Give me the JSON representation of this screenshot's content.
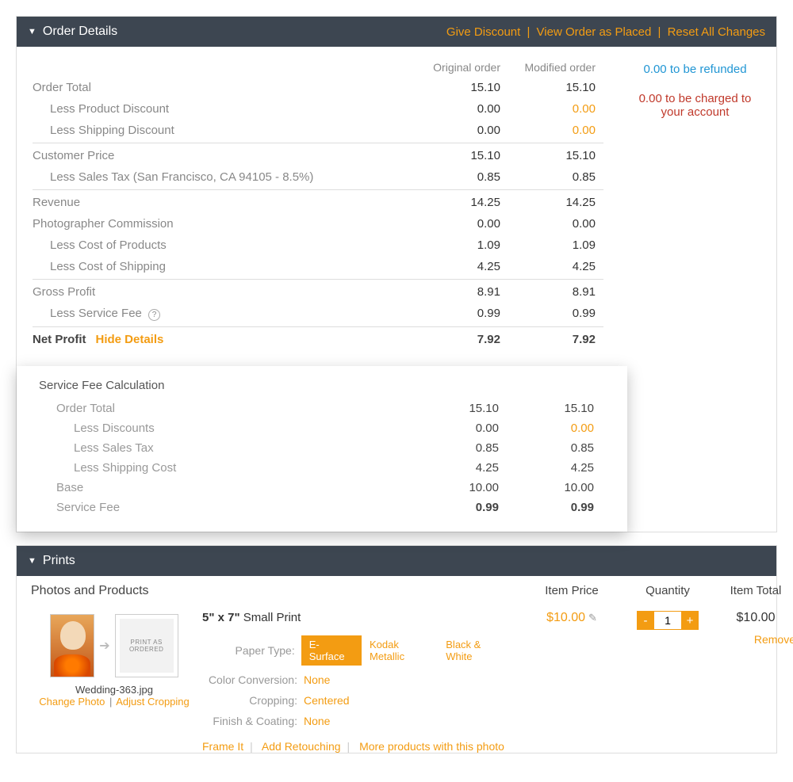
{
  "order_details": {
    "title": "Order Details",
    "header_links": {
      "give_discount": "Give Discount",
      "view_order": "View Order as Placed",
      "reset": "Reset All Changes"
    },
    "col_original": "Original order",
    "col_modified": "Modified order",
    "side": {
      "refund_amount": "0.00",
      "refund_suffix": "to be refunded",
      "charge_amount": "0.00",
      "charge_suffix": "to be charged to your account"
    },
    "rows": {
      "order_total": {
        "label": "Order Total",
        "orig": "15.10",
        "mod": "15.10"
      },
      "less_prod_disc": {
        "label": "Less Product Discount",
        "orig": "0.00",
        "mod": "0.00"
      },
      "less_ship_disc": {
        "label": "Less Shipping Discount",
        "orig": "0.00",
        "mod": "0.00"
      },
      "cust_price": {
        "label": "Customer Price",
        "orig": "15.10",
        "mod": "15.10"
      },
      "less_tax": {
        "label": "Less Sales Tax (San Francisco, CA 94105 - 8.5%)",
        "orig": "0.85",
        "mod": "0.85"
      },
      "revenue": {
        "label": "Revenue",
        "orig": "14.25",
        "mod": "14.25"
      },
      "photog_comm": {
        "label": "Photographer Commission",
        "orig": "0.00",
        "mod": "0.00"
      },
      "less_cost_prod": {
        "label": "Less Cost of Products",
        "orig": "1.09",
        "mod": "1.09"
      },
      "less_cost_ship": {
        "label": "Less Cost of Shipping",
        "orig": "4.25",
        "mod": "4.25"
      },
      "gross_profit": {
        "label": "Gross Profit",
        "orig": "8.91",
        "mod": "8.91"
      },
      "less_svc_fee": {
        "label": "Less Service Fee",
        "orig": "0.99",
        "mod": "0.99"
      },
      "net_profit": {
        "label": "Net Profit",
        "orig": "7.92",
        "mod": "7.92"
      }
    },
    "hide_details": "Hide Details",
    "svc_calc": {
      "title": "Service Fee Calculation",
      "rows": {
        "order_total": {
          "label": "Order Total",
          "orig": "15.10",
          "mod": "15.10"
        },
        "less_disc": {
          "label": "Less Discounts",
          "orig": "0.00",
          "mod": "0.00"
        },
        "less_tax": {
          "label": "Less Sales Tax",
          "orig": "0.85",
          "mod": "0.85"
        },
        "less_ship": {
          "label": "Less Shipping Cost",
          "orig": "4.25",
          "mod": "4.25"
        },
        "base": {
          "label": "Base",
          "orig": "10.00",
          "mod": "10.00"
        },
        "svc_fee": {
          "label": "Service Fee",
          "orig": "0.99",
          "mod": "0.99"
        }
      }
    }
  },
  "prints": {
    "title": "Prints",
    "section_title": "Photos and Products",
    "col_item_price": "Item Price",
    "col_quantity": "Quantity",
    "col_item_total": "Item Total",
    "photo": {
      "print_box_label": "PRINT AS ORDERED",
      "filename": "Wedding-363.jpg",
      "change_photo": "Change Photo",
      "adjust_cropping": "Adjust Cropping"
    },
    "product": {
      "size": "5\" x 7\"",
      "name": "Small Print",
      "paper_type_label": "Paper Type:",
      "paper_types": {
        "selected": "E-Surface",
        "alt1": "Kodak Metallic",
        "alt2": "Black & White"
      },
      "color_conv_label": "Color Conversion:",
      "color_conv_value": "None",
      "cropping_label": "Cropping:",
      "cropping_value": "Centered",
      "finish_label": "Finish & Coating:",
      "finish_value": "None"
    },
    "item_price": "$10.00",
    "quantity": "1",
    "item_total": "$10.00",
    "remove": "Remove",
    "bottom_links": {
      "frame": "Frame It",
      "retouch": "Add Retouching",
      "more": "More products with this photo"
    }
  }
}
